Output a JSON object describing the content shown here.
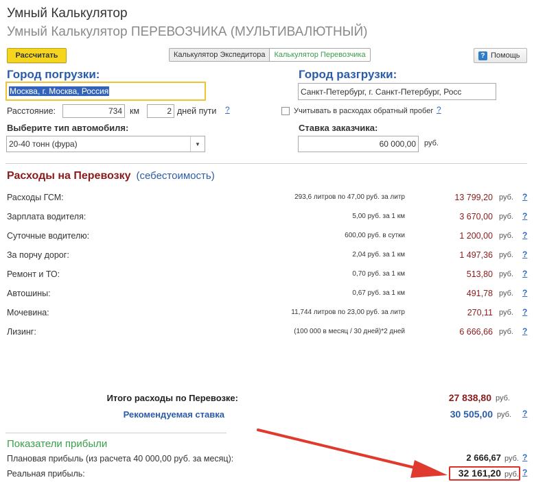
{
  "header": {
    "title": "Умный Калькулятор",
    "subtitle": "Умный Калькулятор ПЕРЕВОЗЧИКА (МУЛЬТИВАЛЮТНЫЙ)"
  },
  "toolbar": {
    "calc_label": "Рассчитать",
    "tabs": [
      "Калькулятор Экспедитора",
      "Калькулятор Перевозчика"
    ],
    "help_label": "Помощь"
  },
  "route": {
    "load_label": "Город погрузки:",
    "load_value": "Москва, г. Москва, Россия",
    "unload_label": "Город разгрузки:",
    "unload_value": "Санкт-Петербург, г. Санкт-Петербург, Росс"
  },
  "distance": {
    "label": "Расстояние:",
    "value": "734",
    "unit": "км",
    "days": "2",
    "days_label": "дней пути"
  },
  "return_run": {
    "label": "Учитывать в расходах обратный пробег",
    "checked": false
  },
  "vehicle": {
    "label": "Выберите тип автомобиля:",
    "value": "20-40 тонн (фура)"
  },
  "rate": {
    "label": "Ставка заказчика:",
    "value": "60 000,00",
    "unit": "руб."
  },
  "costs": {
    "title": "Расходы на Перевозку",
    "subtitle": "(себестоимость)",
    "unit": "руб.",
    "rows": [
      {
        "name": "Расходы ГСМ:",
        "detail": "293,6 литров по 47,00 руб. за литр",
        "value": "13 799,20"
      },
      {
        "name": "Зарплата водителя:",
        "detail": "5,00 руб. за 1 км",
        "value": "3 670,00"
      },
      {
        "name": "Суточные водителю:",
        "detail": "600,00 руб. в сутки",
        "value": "1 200,00"
      },
      {
        "name": "За порчу дорог:",
        "detail": "2,04 руб. за 1 км",
        "value": "1 497,36"
      },
      {
        "name": "Ремонт и ТО:",
        "detail": "0,70 руб. за 1 км",
        "value": "513,80"
      },
      {
        "name": "Автошины:",
        "detail": "0,67 руб. за 1 км",
        "value": "491,78"
      },
      {
        "name": "Мочевина:",
        "detail": "11,744 литров по 23,00 руб. за литр",
        "value": "270,11"
      },
      {
        "name": "Лизинг:",
        "detail": "(100 000 в месяц / 30 дней)*2 дней",
        "value": "6 666,66"
      }
    ]
  },
  "totals": {
    "total_label": "Итого расходы по Перевозке:",
    "total_value": "27 838,80",
    "recommended_label": "Рекомендуемая ставка",
    "recommended_value": "30 505,00",
    "unit": "руб."
  },
  "profit": {
    "title": "Показатели прибыли",
    "planned_label": "Плановая прибыль (из расчета 40 000,00 руб. за месяц):",
    "planned_value": "2 666,67",
    "real_label": "Реальная прибыль:",
    "real_value": "32 161,20",
    "unit": "руб."
  },
  "colors": {
    "accent_blue": "#2b5ca8",
    "cost_red": "#8b1a1a",
    "profit_green": "#3a9e4a",
    "button_yellow": "#f6d51f",
    "annotation_red": "#d9302b"
  }
}
